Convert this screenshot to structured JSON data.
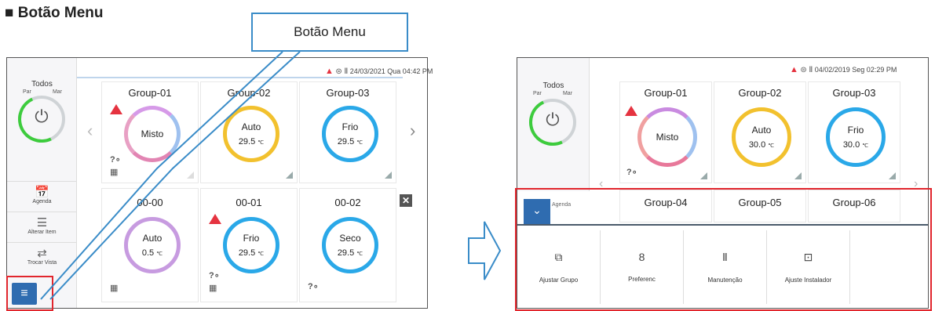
{
  "section_title": "■ Botão Menu",
  "callout_label": "Botão Menu",
  "left_screen": {
    "status_datetime": "24/03/2021 Qua 04:42 PM",
    "sidebar": {
      "todos": "Todos",
      "par": "Par",
      "mar": "Mar",
      "buttons": [
        {
          "label": "Agenda",
          "icon": "calendar-icon"
        },
        {
          "label": "Alterar Item",
          "icon": "list-icon"
        },
        {
          "label": "Trocar Vista",
          "icon": "switch-view-icon"
        }
      ]
    },
    "cards": [
      {
        "name": "Group-01",
        "mode": "Misto",
        "temp": "",
        "ring": "#c98be0"
      },
      {
        "name": "Group-02",
        "mode": "Auto",
        "temp": "29.5",
        "ring": "#f2c12e"
      },
      {
        "name": "Group-03",
        "mode": "Frio",
        "temp": "29.5",
        "ring": "#2aa8e8"
      },
      {
        "name": "00-00",
        "mode": "Auto",
        "temp": "0.5",
        "ring": "#c79be0"
      },
      {
        "name": "00-01",
        "mode": "Frio",
        "temp": "29.5",
        "ring": "#2aa8e8"
      },
      {
        "name": "00-02",
        "mode": "Seco",
        "temp": "29.5",
        "ring": "#2aa8e8"
      }
    ],
    "unit": "℃"
  },
  "right_screen": {
    "status_datetime": "04/02/2019 Seg 02:29 PM",
    "sidebar": {
      "todos": "Todos",
      "par": "Par",
      "mar": "Mar"
    },
    "cards": [
      {
        "name": "Group-01",
        "mode": "Misto",
        "temp": "",
        "ring": "#e8789a"
      },
      {
        "name": "Group-02",
        "mode": "Auto",
        "temp": "30.0",
        "ring": "#f2c12e"
      },
      {
        "name": "Group-03",
        "mode": "Frio",
        "temp": "30.0",
        "ring": "#2aa8e8"
      },
      {
        "name": "Group-04"
      },
      {
        "name": "Group-05"
      },
      {
        "name": "Group-06"
      }
    ],
    "partial_sidebar_label": "Agenda",
    "unit": "℃",
    "menu_items": [
      {
        "label": "Ajustar  Grupo",
        "icon": "group-icon"
      },
      {
        "label": "Preferenc",
        "icon": "user-icon"
      },
      {
        "label": "Manutenção",
        "icon": "maintenance-icon"
      },
      {
        "label": "Ajuste Instalador",
        "icon": "installer-icon"
      }
    ]
  },
  "colors": {
    "accent_blue": "#2f6cb0",
    "highlight_red": "#e1262d",
    "callout_blue": "#3a8cc8",
    "power_green": "#3dcc3d"
  }
}
